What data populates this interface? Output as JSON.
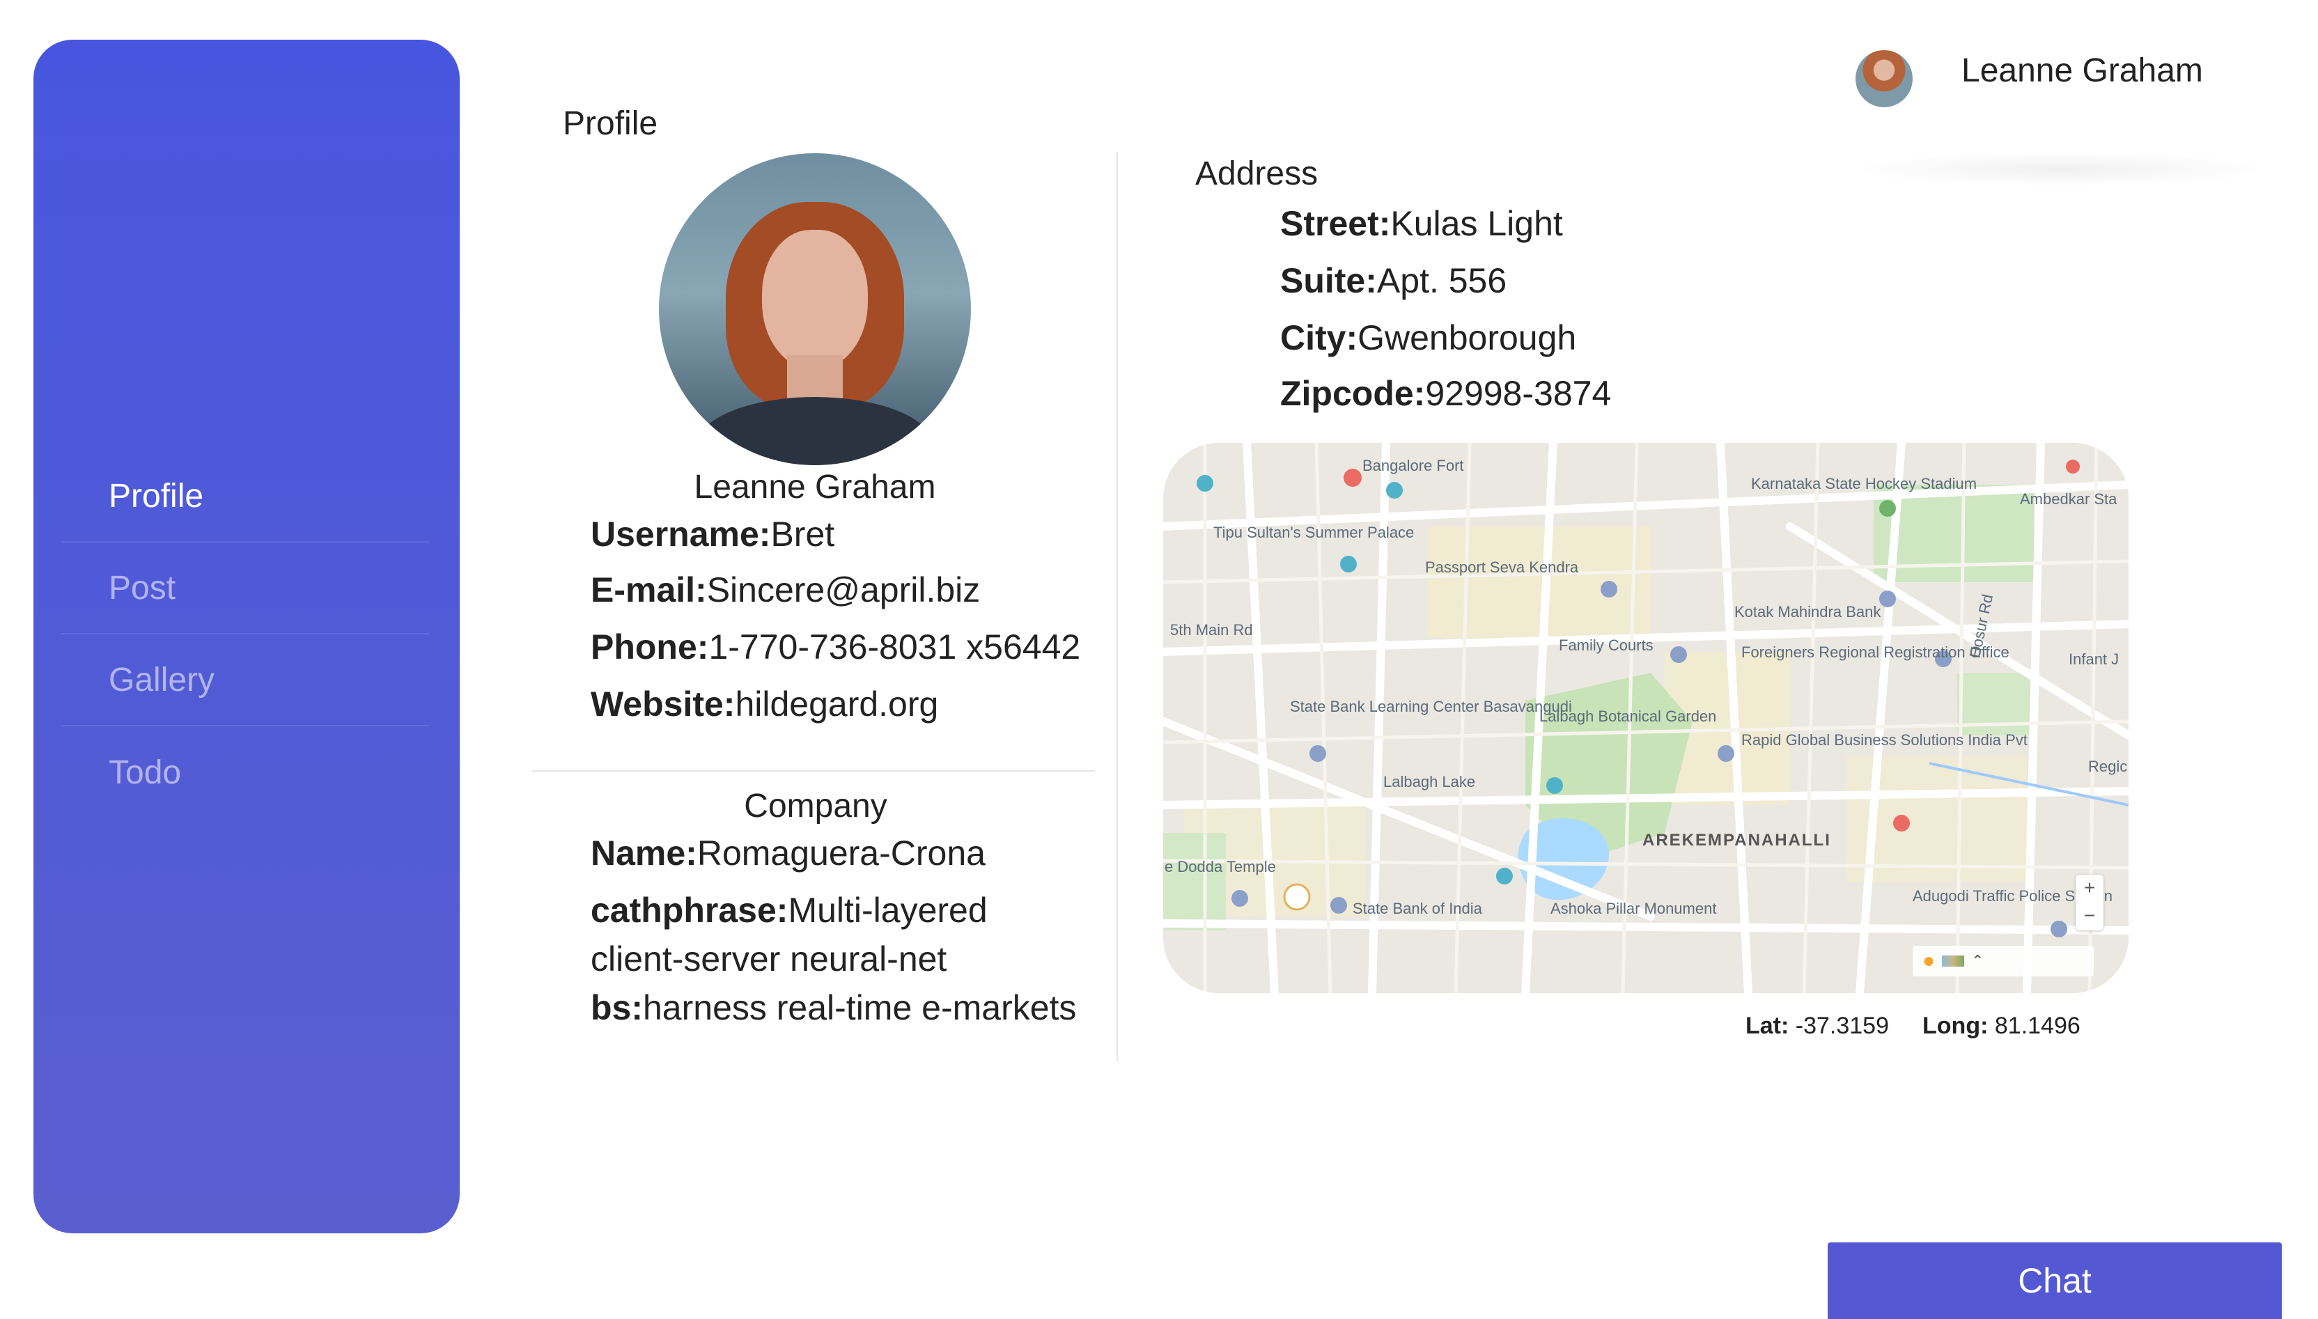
{
  "sidebar": {
    "items": [
      {
        "label": "Profile",
        "active": true
      },
      {
        "label": "Post",
        "active": false
      },
      {
        "label": "Gallery",
        "active": false
      },
      {
        "label": "Todo",
        "active": false
      }
    ]
  },
  "header": {
    "user_name": "Leanne Graham"
  },
  "profile": {
    "section_title": "Profile",
    "name": "Leanne Graham",
    "username_label": "Username:",
    "username": "Bret",
    "email_label": "E-mail:",
    "email": "Sincere@april.biz",
    "phone_label": "Phone:",
    "phone": "1-770-736-8031 x56442",
    "website_label": "Website:",
    "website": "hildegard.org"
  },
  "company": {
    "section_title": "Company",
    "name_label": "Name:",
    "name": "Romaguera-Crona",
    "catchphrase_label": "cathphrase:",
    "catchphrase_line1": "Multi-layered",
    "catchphrase_line2": "client-server neural-net",
    "bs_label": "bs:",
    "bs": "harness real-time e-markets"
  },
  "address": {
    "section_title": "Address",
    "street_label": "Street:",
    "street": "Kulas Light",
    "suite_label": "Suite:",
    "suite": "Apt. 556",
    "city_label": "City:",
    "city": "Gwenborough",
    "zipcode_label": "Zipcode:",
    "zipcode": "92998-3874"
  },
  "map": {
    "places": [
      "Bangalore Fort",
      "Tipu Sultan's Summer Palace",
      "Passport Seva Kendra",
      "Karnataka State Hockey Stadium",
      "Ambedkar Sta",
      "Kotak Mahindra Bank",
      "Family Courts",
      "Foreigners Regional Registration Office",
      "State Bank Learning Center Basavangudi",
      "Lalbagh Botanical Garden",
      "Lalbagh Lake",
      "Rapid Global Business Solutions India Pvt",
      "AREKEMPANAHALLI",
      "State Bank of India",
      "Ashoka Pillar Monument",
      "Adugodi Traffic Police Station",
      "5th Main Rd",
      "Hosur Rd",
      "Infant J",
      "Regic",
      "e Dodda Temple"
    ],
    "zoom_in": "+",
    "zoom_out": "−"
  },
  "coordinates": {
    "lat_label": "Lat:",
    "lat": "-37.3159",
    "long_label": "Long:",
    "long": "81.1496"
  },
  "chat": {
    "label": "Chat"
  },
  "colors": {
    "sidebar_top": "#4856df",
    "sidebar_bottom": "#5a5fcf",
    "chat_button": "#5458d3"
  }
}
